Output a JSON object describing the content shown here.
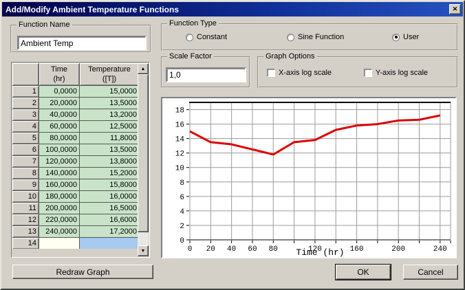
{
  "window": {
    "title": "Add/Modify Ambient Temperature Functions"
  },
  "icons": {
    "close": "✕",
    "scroll_up": "▲",
    "scroll_down": "▼"
  },
  "colors": {
    "accent_red": "#dd0000",
    "cell_green": "#c9e3c9",
    "selected_blue": "#a6caf0",
    "ivory": "#fffff2",
    "titlebar_dark": "#01014a",
    "titlebar_light": "#2552c0",
    "dialog_bg": "#d4d0c8"
  },
  "function_name": {
    "label": "Function Name",
    "value": "Ambient Temp"
  },
  "function_type": {
    "label": "Function Type",
    "options": [
      {
        "label": "Constant",
        "selected": false
      },
      {
        "label": "Sine Function",
        "selected": false
      },
      {
        "label": "User",
        "selected": true
      }
    ]
  },
  "scale_factor": {
    "label": "Scale Factor",
    "value": "1,0"
  },
  "graph_options": {
    "label": "Graph Options",
    "checkboxes": [
      {
        "label": "X-axis log scale",
        "checked": false
      },
      {
        "label": "Y-axis log scale",
        "checked": false
      }
    ]
  },
  "table": {
    "corner": "",
    "col_time_1": "Time",
    "col_time_2": "(hr)",
    "col_temp_1": "Temperature",
    "col_temp_2": "([T])",
    "rows": [
      {
        "n": "1",
        "time": "0,0000",
        "temp": "15,0000"
      },
      {
        "n": "2",
        "time": "20,0000",
        "temp": "13,5000"
      },
      {
        "n": "3",
        "time": "40,0000",
        "temp": "13,2000"
      },
      {
        "n": "4",
        "time": "60,0000",
        "temp": "12,5000"
      },
      {
        "n": "5",
        "time": "80,0000",
        "temp": "11,8000"
      },
      {
        "n": "6",
        "time": "100,0000",
        "temp": "13,5000"
      },
      {
        "n": "7",
        "time": "120,0000",
        "temp": "13,8000"
      },
      {
        "n": "8",
        "time": "140,0000",
        "temp": "15,2000"
      },
      {
        "n": "9",
        "time": "160,0000",
        "temp": "15,8000"
      },
      {
        "n": "10",
        "time": "180,0000",
        "temp": "16,0000"
      },
      {
        "n": "11",
        "time": "200,0000",
        "temp": "16,5000"
      },
      {
        "n": "12",
        "time": "220,0000",
        "temp": "16,6000"
      },
      {
        "n": "13",
        "time": "240,0000",
        "temp": "17,2000"
      },
      {
        "n": "14",
        "time": "",
        "temp": "",
        "time_bg": "ivory",
        "temp_bg": "selected"
      }
    ]
  },
  "buttons": {
    "redraw": "Redraw Graph",
    "ok": "OK",
    "cancel": "Cancel"
  },
  "chart_data": {
    "type": "line",
    "title": "",
    "xlabel": "Time (hr)",
    "ylabel": "",
    "x": [
      0,
      20,
      40,
      60,
      80,
      100,
      120,
      140,
      160,
      180,
      200,
      220,
      240
    ],
    "series": [
      {
        "name": "Ambient Temp",
        "color": "#dd0000",
        "values": [
          15.0,
          13.5,
          13.2,
          12.5,
          11.8,
          13.5,
          13.8,
          15.2,
          15.8,
          16.0,
          16.5,
          16.6,
          17.2
        ]
      }
    ],
    "xlim": [
      0,
      250
    ],
    "ylim": [
      0,
      19
    ],
    "x_ticks": [
      0,
      20,
      40,
      60,
      80,
      100,
      120,
      140,
      160,
      180,
      200,
      220,
      240,
      250
    ],
    "x_labeled_ticks": [
      0,
      20,
      40,
      60,
      80,
      120,
      160,
      200,
      240
    ],
    "y_ticks": [
      0,
      2,
      4,
      6,
      8,
      10,
      12,
      14,
      16,
      18
    ],
    "grid": true,
    "legend": "none"
  }
}
